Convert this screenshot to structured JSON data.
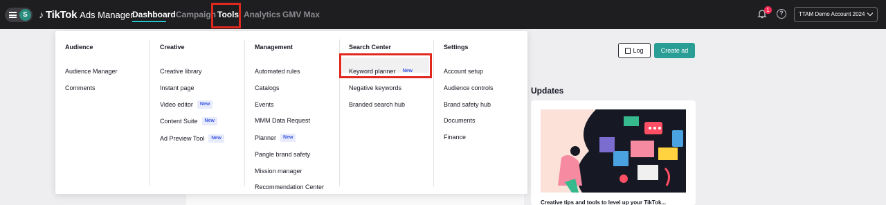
{
  "topbar": {
    "avatar_initial": "S",
    "logo_note": "♪",
    "brand": "TikTok",
    "product": "Ads Manager",
    "nav": [
      "Dashboard",
      "Campaign",
      "Tools",
      "Analytics",
      "GMV Max"
    ],
    "active_nav": "Dashboard",
    "notification_count": "1",
    "help_glyph": "?",
    "account_name": "TTAM Demo Account 2024"
  },
  "page": {
    "log_button": "Log",
    "create_ad_button": "Create ad",
    "updates_title": "Updates",
    "updates_caption": "Creative tips and tools to level up your TikTok..."
  },
  "dropdown": {
    "new_tag": "New",
    "columns": [
      {
        "title": "Audience",
        "items": [
          {
            "label": "Audience Manager"
          },
          {
            "label": "Comments"
          }
        ]
      },
      {
        "title": "Creative",
        "items": [
          {
            "label": "Creative library"
          },
          {
            "label": "Instant page"
          },
          {
            "label": "Video editor",
            "new": true
          },
          {
            "label": "Content Suite",
            "new": true
          },
          {
            "label": "Ad Preview Tool",
            "new": true
          }
        ]
      },
      {
        "title": "Management",
        "items": [
          {
            "label": "Automated rules"
          },
          {
            "label": "Catalogs"
          },
          {
            "label": "Events"
          },
          {
            "label": "MMM Data Request"
          },
          {
            "label": "Planner",
            "new": true
          },
          {
            "label": "Pangle brand safety"
          },
          {
            "label": "Mission manager"
          },
          {
            "label": "Recommendation Center"
          }
        ]
      },
      {
        "title": "Search Center",
        "items": [
          {
            "label": "Keyword planner",
            "new": true,
            "highlighted": true
          },
          {
            "label": "Negative keywords"
          },
          {
            "label": "Branded search hub"
          }
        ]
      },
      {
        "title": "Settings",
        "items": [
          {
            "label": "Account setup"
          },
          {
            "label": "Audience controls"
          },
          {
            "label": "Brand safety hub"
          },
          {
            "label": "Documents"
          },
          {
            "label": "Finance"
          }
        ]
      }
    ]
  },
  "colors": {
    "topbar_bg": "#1e1e21",
    "accent_teal": "#2a9d94",
    "annotation_red": "#e0281f",
    "new_tag_text": "#3e5be3"
  }
}
